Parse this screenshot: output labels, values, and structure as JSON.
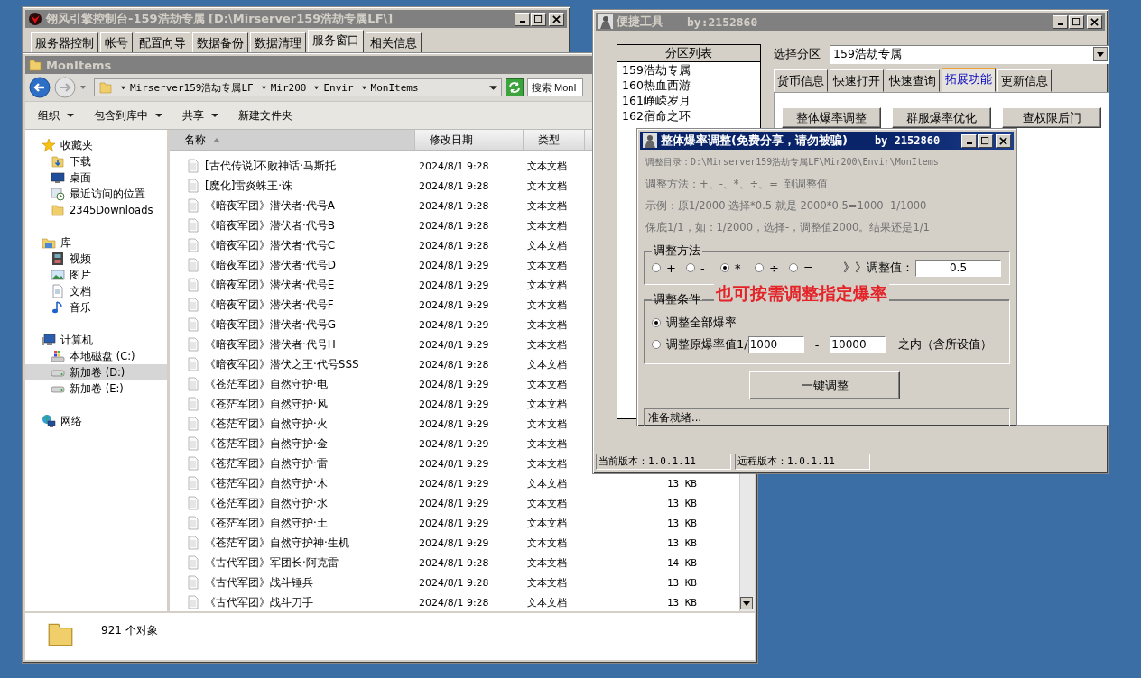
{
  "console_window": {
    "title": "翎风引擎控制台-159浩劫专属 [D:\\Mirserver159浩劫专属LF\\]",
    "active": false,
    "tabs": [
      {
        "label": "服务器控制",
        "selected": false
      },
      {
        "label": "帐号",
        "selected": false
      },
      {
        "label": "配置向导",
        "selected": false
      },
      {
        "label": "数据备份",
        "selected": false
      },
      {
        "label": "数据清理",
        "selected": false
      },
      {
        "label": "服务窗口",
        "selected": true
      },
      {
        "label": "相关信息",
        "selected": false
      }
    ]
  },
  "explorer": {
    "title": "MonItems",
    "active": false,
    "breadcrumb": [
      "Mirserver159浩劫专属LF",
      "Mir200",
      "Envir",
      "MonItems"
    ],
    "search": {
      "placeholder": "搜索 MonI"
    },
    "toolbar": [
      {
        "label": "组织",
        "dropdown": true
      },
      {
        "label": "包含到库中",
        "dropdown": true
      },
      {
        "label": "共享",
        "dropdown": true
      },
      {
        "label": "新建文件夹",
        "dropdown": false
      }
    ],
    "nav": [
      {
        "label": "收藏夹",
        "kind": "favorites",
        "selected": false,
        "children": [
          {
            "label": "下载",
            "kind": "downloads",
            "selected": false
          },
          {
            "label": "桌面",
            "kind": "desktop",
            "selected": false
          },
          {
            "label": "最近访问的位置",
            "kind": "recent",
            "selected": false
          },
          {
            "label": "2345Downloads",
            "kind": "folder",
            "selected": false
          }
        ]
      },
      {
        "label": "库",
        "kind": "library",
        "selected": false,
        "children": [
          {
            "label": "视频",
            "kind": "videos",
            "selected": false
          },
          {
            "label": "图片",
            "kind": "pictures",
            "selected": false
          },
          {
            "label": "文档",
            "kind": "documents",
            "selected": false
          },
          {
            "label": "音乐",
            "kind": "music",
            "selected": false
          }
        ]
      },
      {
        "label": "计算机",
        "kind": "computer",
        "selected": false,
        "children": [
          {
            "label": "本地磁盘 (C:)",
            "kind": "system-disk",
            "selected": false
          },
          {
            "label": "新加卷 (D:)",
            "kind": "drive",
            "selected": true
          },
          {
            "label": "新加卷 (E:)",
            "kind": "drive",
            "selected": false
          }
        ]
      },
      {
        "label": "网络",
        "kind": "network",
        "selected": false
      }
    ],
    "columns": [
      {
        "label": "名称",
        "sorted": true
      },
      {
        "label": "修改日期",
        "sorted": false
      },
      {
        "label": "类型",
        "sorted": false
      }
    ],
    "rows": [
      {
        "name": "[古代传说]不败神话·马斯托",
        "modified": "2024/8/1 9:28",
        "type": "文本文档"
      },
      {
        "name": "[魔化]雷炎蛛王·诛",
        "modified": "2024/8/1 9:28",
        "type": "文本文档"
      },
      {
        "name": "《暗夜军团》潜伏者·代号A",
        "modified": "2024/8/1 9:28",
        "type": "文本文档"
      },
      {
        "name": "《暗夜军团》潜伏者·代号B",
        "modified": "2024/8/1 9:28",
        "type": "文本文档"
      },
      {
        "name": "《暗夜军团》潜伏者·代号C",
        "modified": "2024/8/1 9:28",
        "type": "文本文档"
      },
      {
        "name": "《暗夜军团》潜伏者·代号D",
        "modified": "2024/8/1 9:29",
        "type": "文本文档"
      },
      {
        "name": "《暗夜军团》潜伏者·代号E",
        "modified": "2024/8/1 9:29",
        "type": "文本文档"
      },
      {
        "name": "《暗夜军团》潜伏者·代号F",
        "modified": "2024/8/1 9:29",
        "type": "文本文档"
      },
      {
        "name": "《暗夜军团》潜伏者·代号G",
        "modified": "2024/8/1 9:29",
        "type": "文本文档"
      },
      {
        "name": "《暗夜军团》潜伏者·代号H",
        "modified": "2024/8/1 9:29",
        "type": "文本文档"
      },
      {
        "name": "《暗夜军团》潜伏之王·代号SSS",
        "modified": "2024/8/1 9:28",
        "type": "文本文档"
      },
      {
        "name": "《苍茫军团》自然守护·电",
        "modified": "2024/8/1 9:29",
        "type": "文本文档"
      },
      {
        "name": "《苍茫军团》自然守护·风",
        "modified": "2024/8/1 9:29",
        "type": "文本文档"
      },
      {
        "name": "《苍茫军团》自然守护·火",
        "modified": "2024/8/1 9:29",
        "type": "文本文档"
      },
      {
        "name": "《苍茫军团》自然守护·金",
        "modified": "2024/8/1 9:29",
        "type": "文本文档"
      },
      {
        "name": "《苍茫军团》自然守护·雷",
        "modified": "2024/8/1 9:29",
        "type": "文本文档"
      },
      {
        "name": "《苍茫军团》自然守护·木",
        "modified": "2024/8/1 9:29",
        "type": "文本文档",
        "size": "13 KB"
      },
      {
        "name": "《苍茫军团》自然守护·水",
        "modified": "2024/8/1 9:29",
        "type": "文本文档",
        "size": "13 KB"
      },
      {
        "name": "《苍茫军团》自然守护·土",
        "modified": "2024/8/1 9:29",
        "type": "文本文档",
        "size": "13 KB"
      },
      {
        "name": "《苍茫军团》自然守护神·生机",
        "modified": "2024/8/1 9:29",
        "type": "文本文档",
        "size": "13 KB"
      },
      {
        "name": "《古代军团》军团长·阿克雷",
        "modified": "2024/8/1 9:28",
        "type": "文本文档",
        "size": "14 KB"
      },
      {
        "name": "《古代军团》战斗锤兵",
        "modified": "2024/8/1 9:28",
        "type": "文本文档",
        "size": "13 KB"
      },
      {
        "name": "《古代军团》战斗刀手",
        "modified": "2024/8/1 9:28",
        "type": "文本文档",
        "size": "13 KB"
      }
    ],
    "status": "921 个对象"
  },
  "quick_tools": {
    "title": "便捷工具",
    "byline": "by:2152860",
    "active": false,
    "list_header": "分区列表",
    "partitions": [
      "159浩劫专属",
      "160热血西游",
      "161峥嵘岁月",
      "162宿命之环"
    ],
    "select_label": "选择分区",
    "select_value": "159浩劫专属",
    "tabs": [
      {
        "label": "货币信息",
        "selected": false
      },
      {
        "label": "快速打开",
        "selected": false
      },
      {
        "label": "快速查询",
        "selected": false
      },
      {
        "label": "拓展功能",
        "selected": true
      },
      {
        "label": "更新信息",
        "selected": false
      }
    ],
    "buttons": [
      "整体爆率调整",
      "群服爆率优化",
      "查权限后门"
    ],
    "status": [
      "当前版本：1.0.1.11",
      "远程版本：1.0.1.11"
    ]
  },
  "dialog": {
    "title": "整体爆率调整(免费分享，请勿被骗)",
    "byline": "by 2152860",
    "active": true,
    "info": [
      "调整目录：D:\\Mirserver159浩劫专属LF\\Mir200\\Envir\\MonItems",
      "调整方法：+、-、*、÷、=  到调整值",
      "示例：原1/2000 选择*0.5 就是 2000*0.5=1000  1/1000",
      "保底1/1，如：1/2000，选择-，调整值2000。结果还是1/1"
    ],
    "method_group": {
      "legend": "调整方法",
      "options": [
        {
          "label": "+",
          "selected": false
        },
        {
          "label": "-",
          "selected": false
        },
        {
          "label": "*",
          "selected": true
        },
        {
          "label": "÷",
          "selected": false
        },
        {
          "label": "=",
          "selected": false
        }
      ],
      "value_label": "》》调整值：",
      "value": "0.5"
    },
    "condition_group": {
      "legend": "调整条件",
      "options": [
        {
          "label": "调整全部爆率",
          "selected": true
        },
        {
          "label": "调整原爆率值1/",
          "selected": false
        }
      ],
      "range_from": "1000",
      "range_sep": "-",
      "range_to": "10000",
      "range_suffix": "之内（含所设值）"
    },
    "apply_button": "一键调整",
    "status": "准备就绪..."
  },
  "annotation": "也可按需调整指定爆率"
}
